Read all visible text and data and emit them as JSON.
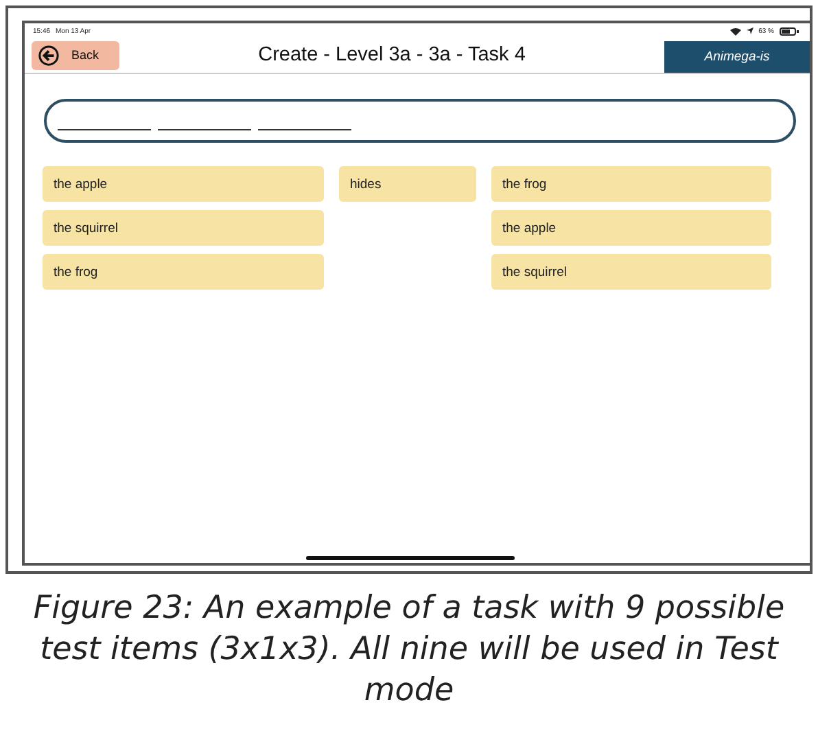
{
  "status_bar": {
    "time": "15:46",
    "date": "Mon 13 Apr",
    "battery": "63 %"
  },
  "header": {
    "back": "Back",
    "title": "Create - Level 3a - 3a - Task 4",
    "brand": "Animega-is"
  },
  "answer": {
    "slots": [
      {
        "filled": false
      },
      {
        "filled": false
      },
      {
        "filled": false
      }
    ]
  },
  "columns": [
    {
      "tiles": [
        "the apple",
        "the squirrel",
        "the frog"
      ]
    },
    {
      "tiles": [
        "hides"
      ]
    },
    {
      "tiles": [
        "the frog",
        "the apple",
        "the squirrel"
      ]
    }
  ],
  "caption": "Figure 23: An example of a task with 9 possible test items (3x1x3). All nine will be used in Test mode"
}
